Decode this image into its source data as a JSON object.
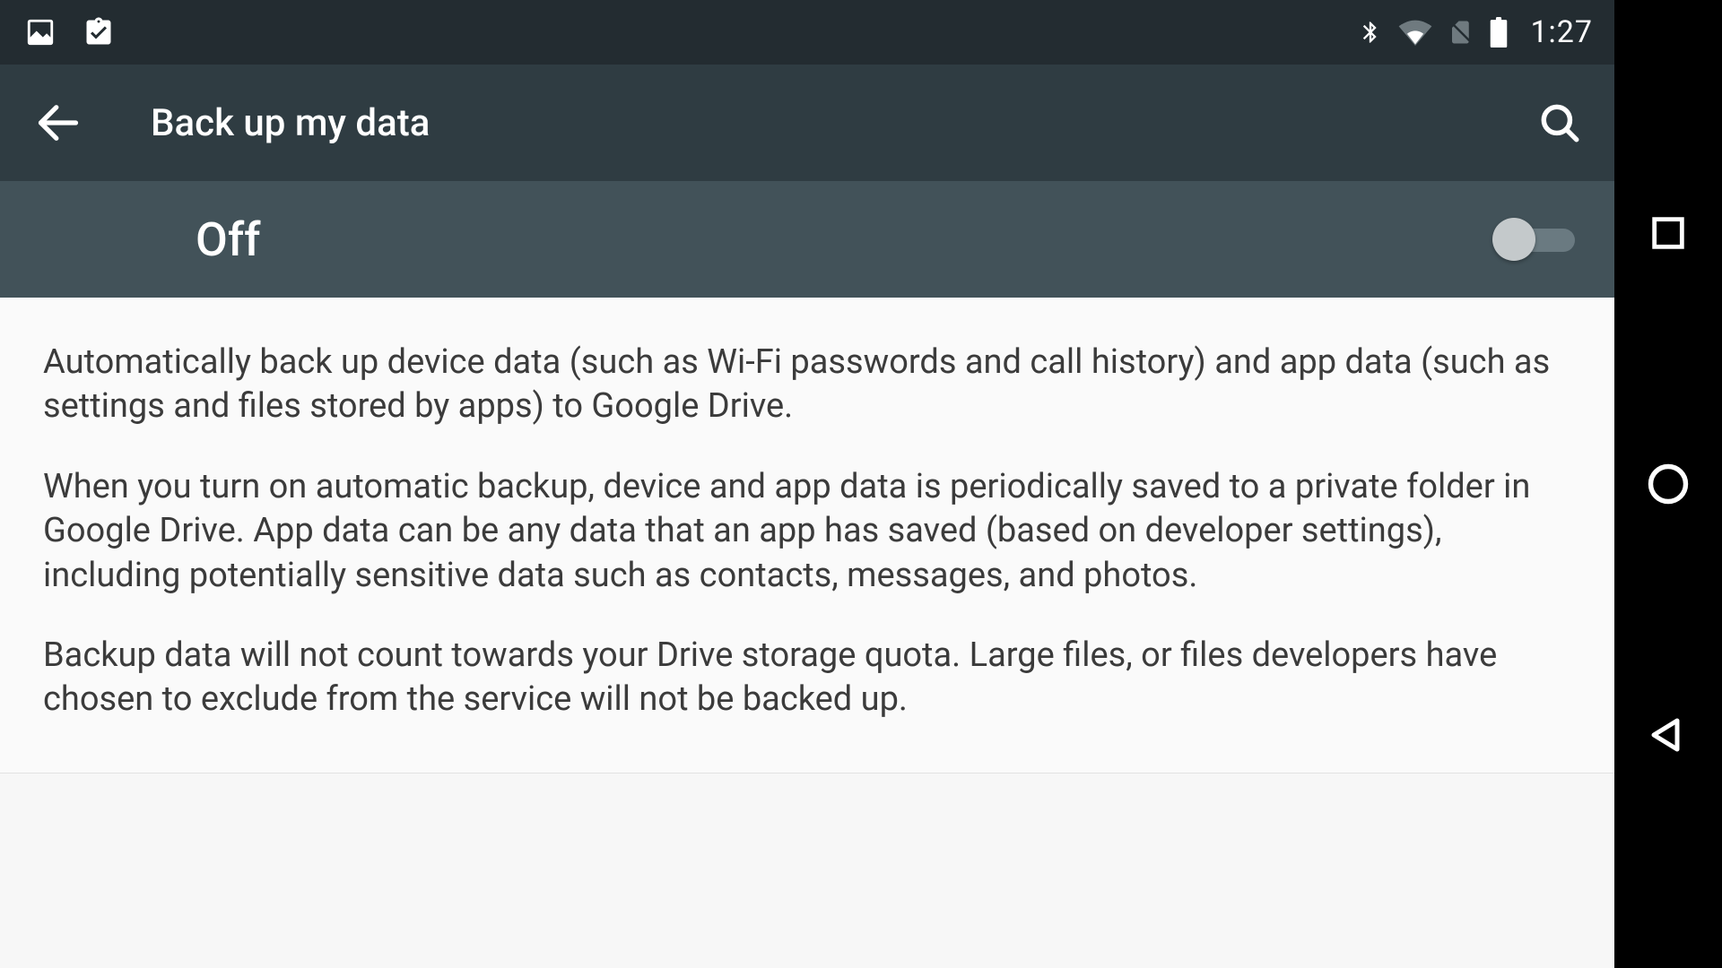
{
  "statusbar": {
    "time": "1:27"
  },
  "actionbar": {
    "title": "Back up my data"
  },
  "toggle": {
    "state_label": "Off",
    "enabled": false
  },
  "description": {
    "p1": "Automatically back up device data (such as Wi-Fi passwords and call history) and app data (such as settings and files stored by apps) to Google Drive.",
    "p2": "When you turn on automatic backup, device and app data is periodically saved to a private folder in Google Drive. App data can be any data that an app has saved (based on developer settings), including potentially sensitive data such as contacts, messages, and photos.",
    "p3": "Backup data will not count towards your Drive storage quota. Large files, or files developers have chosen to exclude from the service will not be backed up."
  }
}
